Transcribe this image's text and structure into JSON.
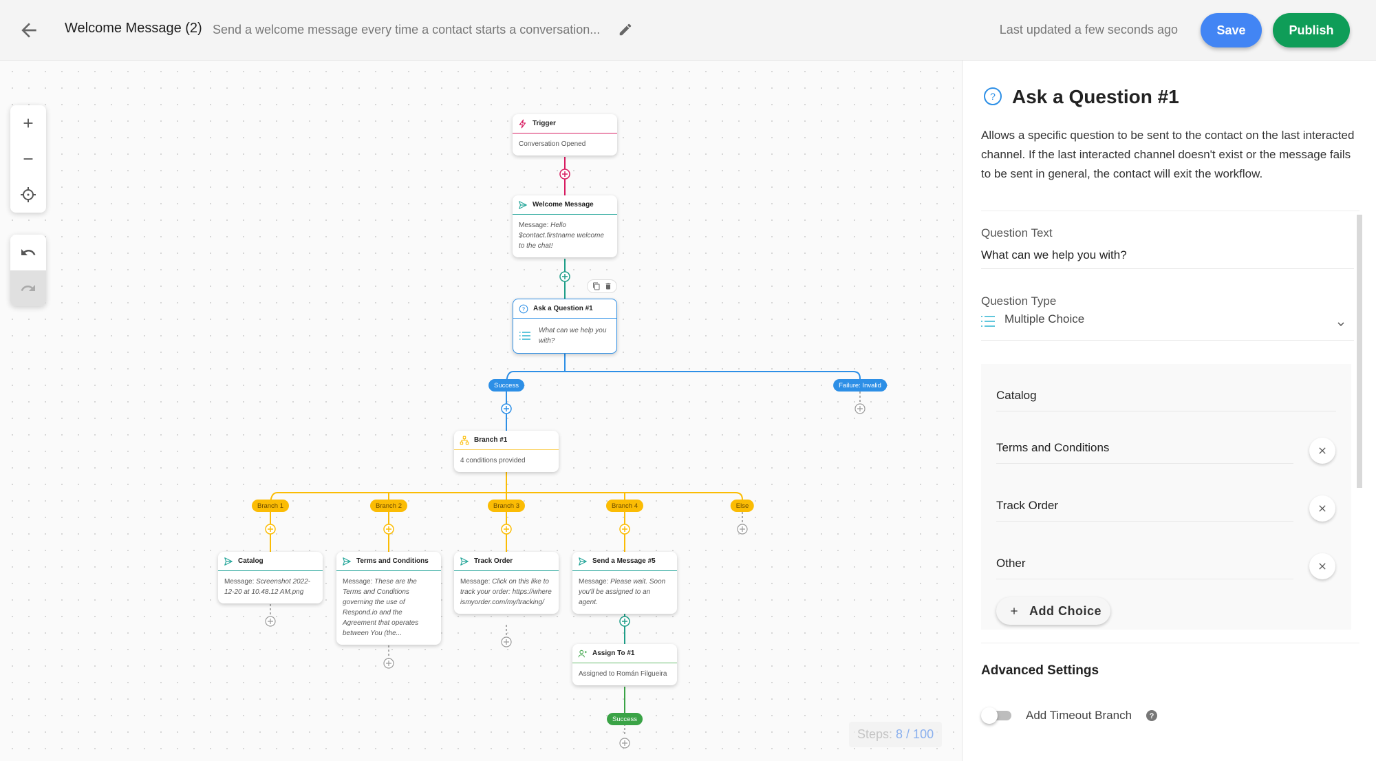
{
  "header": {
    "title": "Welcome Message (2)",
    "description": "Send a welcome message every time a contact starts a conversation...",
    "last_updated": "Last updated a few seconds ago",
    "save_label": "Save",
    "publish_label": "Publish"
  },
  "colors": {
    "save": "#4285f4",
    "publish": "#0f9d58",
    "trigger": "#d81b60",
    "message": "#26a69a",
    "question": "#2d8fe6",
    "branch": "#fbbc04",
    "assign": "#3aa346"
  },
  "toolbar": {
    "zoom_in": "zoom-in",
    "zoom_out": "zoom-out",
    "recenter": "recenter",
    "undo": "undo",
    "redo": "redo"
  },
  "steps": {
    "label": "Steps:",
    "count": "8 / 100",
    "used": 8,
    "max": 100
  },
  "nodes": {
    "trigger": {
      "title": "Trigger",
      "body": "Conversation Opened"
    },
    "welcome": {
      "title": "Welcome Message",
      "prefix": "Message:",
      "body": "Hello $contact.firstname welcome to the chat!"
    },
    "question": {
      "title": "Ask a Question #1",
      "body": "What can we help you with?"
    },
    "branch": {
      "title": "Branch #1",
      "body": "4 conditions provided"
    },
    "catalog": {
      "title": "Catalog",
      "prefix": "Message:",
      "body": "Screenshot 2022-12-20 at 10.48.12 AM.png"
    },
    "terms": {
      "title": "Terms and Conditions",
      "prefix": "Message:",
      "body": "These are the Terms and Conditions governing the use of Respond.io and the Agreement that operates between You (the..."
    },
    "track": {
      "title": "Track Order",
      "prefix": "Message:",
      "body": "Click on this like to track your order: https://whereismyorder.com/my/tracking/"
    },
    "send5": {
      "title": "Send a Message #5",
      "prefix": "Message:",
      "body": "Please wait. Soon you'll be assigned to an agent."
    },
    "assign": {
      "title": "Assign To #1",
      "body": "Assigned to Román Filgueira"
    }
  },
  "pills": {
    "success": "Success",
    "failure": "Failure: Invalid",
    "branch1": "Branch 1",
    "branch2": "Branch 2",
    "branch3": "Branch 3",
    "branch4": "Branch 4",
    "else": "Else",
    "assign_success": "Success"
  },
  "panel": {
    "title": "Ask a Question #1",
    "description": "Allows a specific question to be sent to the contact on the last interacted channel. If the last interacted channel doesn't exist or the message fails to be sent in general, the contact will exit the workflow.",
    "question_text_label": "Question Text",
    "question_text_value": "What can we help you with?",
    "question_type_label": "Question Type",
    "question_type_value": "Multiple Choice",
    "choices": [
      {
        "value": "Catalog",
        "removable": false
      },
      {
        "value": "Terms and Conditions",
        "removable": true
      },
      {
        "value": "Track Order",
        "removable": true
      },
      {
        "value": "Other",
        "removable": true
      }
    ],
    "add_choice_label": "Add Choice",
    "advanced_title": "Advanced Settings",
    "timeout_label": "Add Timeout Branch",
    "timeout_enabled": false
  }
}
